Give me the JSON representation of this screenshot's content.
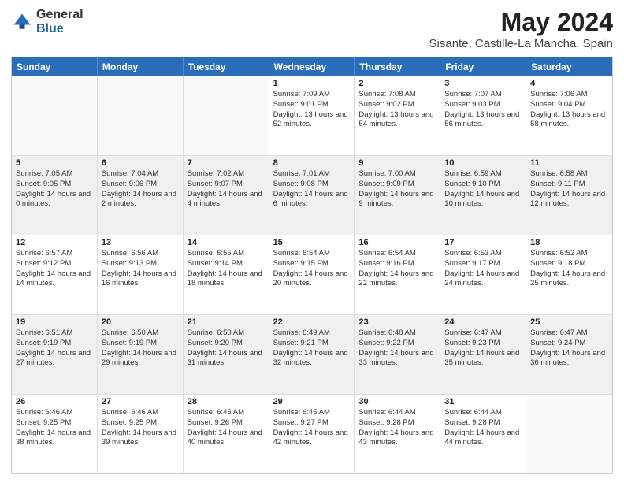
{
  "logo": {
    "general": "General",
    "blue": "Blue"
  },
  "title": "May 2024",
  "subtitle": "Sisante, Castille-La Mancha, Spain",
  "days": [
    "Sunday",
    "Monday",
    "Tuesday",
    "Wednesday",
    "Thursday",
    "Friday",
    "Saturday"
  ],
  "weeks": [
    [
      {
        "day": "",
        "empty": true
      },
      {
        "day": "",
        "empty": true
      },
      {
        "day": "",
        "empty": true
      },
      {
        "day": "1",
        "sunrise": "7:09 AM",
        "sunset": "9:01 PM",
        "daylight": "13 hours and 52 minutes."
      },
      {
        "day": "2",
        "sunrise": "7:08 AM",
        "sunset": "9:02 PM",
        "daylight": "13 hours and 54 minutes."
      },
      {
        "day": "3",
        "sunrise": "7:07 AM",
        "sunset": "9:03 PM",
        "daylight": "13 hours and 56 minutes."
      },
      {
        "day": "4",
        "sunrise": "7:06 AM",
        "sunset": "9:04 PM",
        "daylight": "13 hours and 58 minutes."
      }
    ],
    [
      {
        "day": "5",
        "sunrise": "7:05 AM",
        "sunset": "9:05 PM",
        "daylight": "14 hours and 0 minutes."
      },
      {
        "day": "6",
        "sunrise": "7:04 AM",
        "sunset": "9:06 PM",
        "daylight": "14 hours and 2 minutes."
      },
      {
        "day": "7",
        "sunrise": "7:02 AM",
        "sunset": "9:07 PM",
        "daylight": "14 hours and 4 minutes."
      },
      {
        "day": "8",
        "sunrise": "7:01 AM",
        "sunset": "9:08 PM",
        "daylight": "14 hours and 6 minutes."
      },
      {
        "day": "9",
        "sunrise": "7:00 AM",
        "sunset": "9:09 PM",
        "daylight": "14 hours and 9 minutes."
      },
      {
        "day": "10",
        "sunrise": "6:59 AM",
        "sunset": "9:10 PM",
        "daylight": "14 hours and 10 minutes."
      },
      {
        "day": "11",
        "sunrise": "6:58 AM",
        "sunset": "9:11 PM",
        "daylight": "14 hours and 12 minutes."
      }
    ],
    [
      {
        "day": "12",
        "sunrise": "6:57 AM",
        "sunset": "9:12 PM",
        "daylight": "14 hours and 14 minutes."
      },
      {
        "day": "13",
        "sunrise": "6:56 AM",
        "sunset": "9:13 PM",
        "daylight": "14 hours and 16 minutes."
      },
      {
        "day": "14",
        "sunrise": "6:55 AM",
        "sunset": "9:14 PM",
        "daylight": "14 hours and 18 minutes."
      },
      {
        "day": "15",
        "sunrise": "6:54 AM",
        "sunset": "9:15 PM",
        "daylight": "14 hours and 20 minutes."
      },
      {
        "day": "16",
        "sunrise": "6:54 AM",
        "sunset": "9:16 PM",
        "daylight": "14 hours and 22 minutes."
      },
      {
        "day": "17",
        "sunrise": "6:53 AM",
        "sunset": "9:17 PM",
        "daylight": "14 hours and 24 minutes."
      },
      {
        "day": "18",
        "sunrise": "6:52 AM",
        "sunset": "9:18 PM",
        "daylight": "14 hours and 25 minutes."
      }
    ],
    [
      {
        "day": "19",
        "sunrise": "6:51 AM",
        "sunset": "9:19 PM",
        "daylight": "14 hours and 27 minutes."
      },
      {
        "day": "20",
        "sunrise": "6:50 AM",
        "sunset": "9:19 PM",
        "daylight": "14 hours and 29 minutes."
      },
      {
        "day": "21",
        "sunrise": "6:50 AM",
        "sunset": "9:20 PM",
        "daylight": "14 hours and 31 minutes."
      },
      {
        "day": "22",
        "sunrise": "6:49 AM",
        "sunset": "9:21 PM",
        "daylight": "14 hours and 32 minutes."
      },
      {
        "day": "23",
        "sunrise": "6:48 AM",
        "sunset": "9:22 PM",
        "daylight": "14 hours and 33 minutes."
      },
      {
        "day": "24",
        "sunrise": "6:47 AM",
        "sunset": "9:23 PM",
        "daylight": "14 hours and 35 minutes."
      },
      {
        "day": "25",
        "sunrise": "6:47 AM",
        "sunset": "9:24 PM",
        "daylight": "14 hours and 36 minutes."
      }
    ],
    [
      {
        "day": "26",
        "sunrise": "6:46 AM",
        "sunset": "9:25 PM",
        "daylight": "14 hours and 38 minutes."
      },
      {
        "day": "27",
        "sunrise": "6:46 AM",
        "sunset": "9:25 PM",
        "daylight": "14 hours and 39 minutes."
      },
      {
        "day": "28",
        "sunrise": "6:45 AM",
        "sunset": "9:26 PM",
        "daylight": "14 hours and 40 minutes."
      },
      {
        "day": "29",
        "sunrise": "6:45 AM",
        "sunset": "9:27 PM",
        "daylight": "14 hours and 42 minutes."
      },
      {
        "day": "30",
        "sunrise": "6:44 AM",
        "sunset": "9:28 PM",
        "daylight": "14 hours and 43 minutes."
      },
      {
        "day": "31",
        "sunrise": "6:44 AM",
        "sunset": "9:28 PM",
        "daylight": "14 hours and 44 minutes."
      },
      {
        "day": "",
        "empty": true
      }
    ]
  ]
}
